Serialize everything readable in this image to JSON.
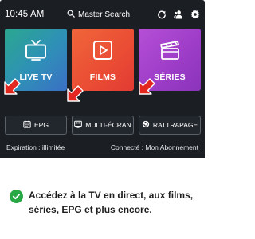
{
  "statusbar": {
    "time": "10:45 AM"
  },
  "search": {
    "label": "Master Search"
  },
  "tiles": [
    {
      "label": "LIVE TV"
    },
    {
      "label": "FILMS"
    },
    {
      "label": "SÉRIES"
    }
  ],
  "buttons": [
    {
      "label": "EPG"
    },
    {
      "label": "MULTI-ÉCRAN"
    },
    {
      "label": "RATTRAPAGE"
    }
  ],
  "footer": {
    "expiration": "Expiration : illimitée",
    "account": "Connecté : Mon Abonnement"
  },
  "caption": {
    "text": "Accédez à la TV en direct, aux films, séries, EPG et plus encore."
  },
  "colors": {
    "app_bg": "#1b1f24",
    "live_tv": "#2f8fb8",
    "films": "#ea4c34",
    "series": "#9c3cc7",
    "arrow": "#e3261f",
    "check": "#27a844"
  },
  "icons": {
    "search": "search-icon",
    "refresh": "refresh-icon",
    "profile": "profile-icon",
    "settings": "gear-icon",
    "live_tv": "tv-icon",
    "films": "play-icon",
    "series": "clapperboard-icon",
    "epg": "calendar-icon",
    "multi": "multiscreen-icon",
    "catchup": "replay-icon",
    "check": "check-icon"
  }
}
